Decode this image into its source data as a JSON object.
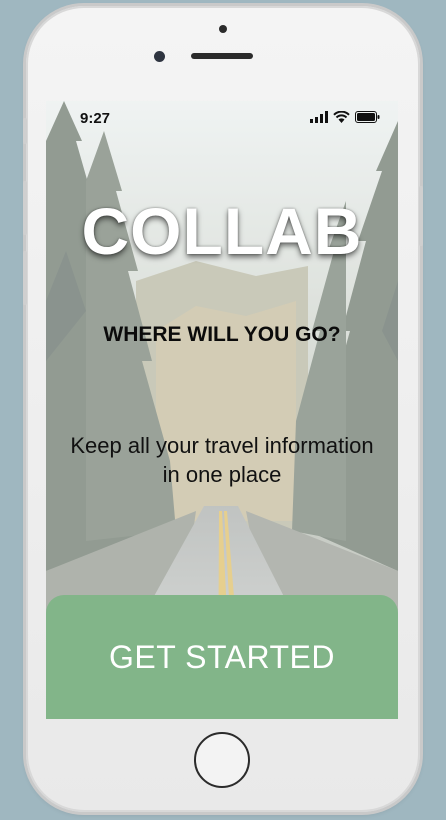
{
  "status_bar": {
    "time": "9:27"
  },
  "app": {
    "logo_text": "COLLAB"
  },
  "hero": {
    "tagline": "WHERE WILL YOU GO?",
    "description": "Keep all your travel information in one place"
  },
  "cta": {
    "label": "GET STARTED"
  },
  "colors": {
    "cta_background": "#82b589",
    "logo_text": "#ffffff",
    "page_background": "#9fb7c0"
  },
  "icons": [
    "signal-icon",
    "wifi-icon",
    "battery-icon"
  ]
}
